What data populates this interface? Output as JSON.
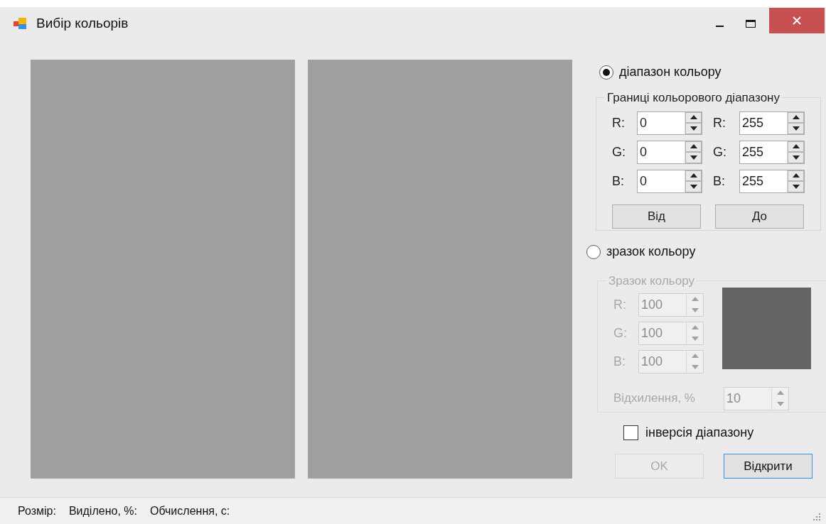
{
  "window": {
    "title": "Вибір кольорів"
  },
  "mode_options": [
    {
      "label": "діапазон кольору",
      "selected": true
    },
    {
      "label": "зразок кольору",
      "selected": false
    }
  ],
  "range_group": {
    "title": "Границі кольорового діапазону",
    "disabled": false,
    "rows": [
      {
        "from_label": "R:",
        "from_value": "0",
        "to_label": "R:",
        "to_value": "255"
      },
      {
        "from_label": "G:",
        "from_value": "0",
        "to_label": "G:",
        "to_value": "255"
      },
      {
        "from_label": "B:",
        "from_value": "0",
        "to_label": "B:",
        "to_value": "255"
      }
    ],
    "buttons": [
      "Від",
      "До"
    ]
  },
  "sample_group": {
    "title": "Зразок кольору",
    "disabled": true,
    "rows": [
      {
        "label": "R:",
        "value": "100"
      },
      {
        "label": "G:",
        "value": "100"
      },
      {
        "label": "B:",
        "value": "100"
      }
    ],
    "deviation": {
      "label": "Відхилення, %",
      "value": "10"
    }
  },
  "inversion": {
    "label": "інверсія діапазону",
    "checked": false
  },
  "buttons": [
    {
      "label": "OK",
      "disabled": true,
      "focused": false
    },
    {
      "label": "Відкрити",
      "disabled": false,
      "focused": true
    }
  ],
  "status_bar": [
    "Розмір:",
    "Виділено, %:",
    "Обчислення, с:"
  ]
}
